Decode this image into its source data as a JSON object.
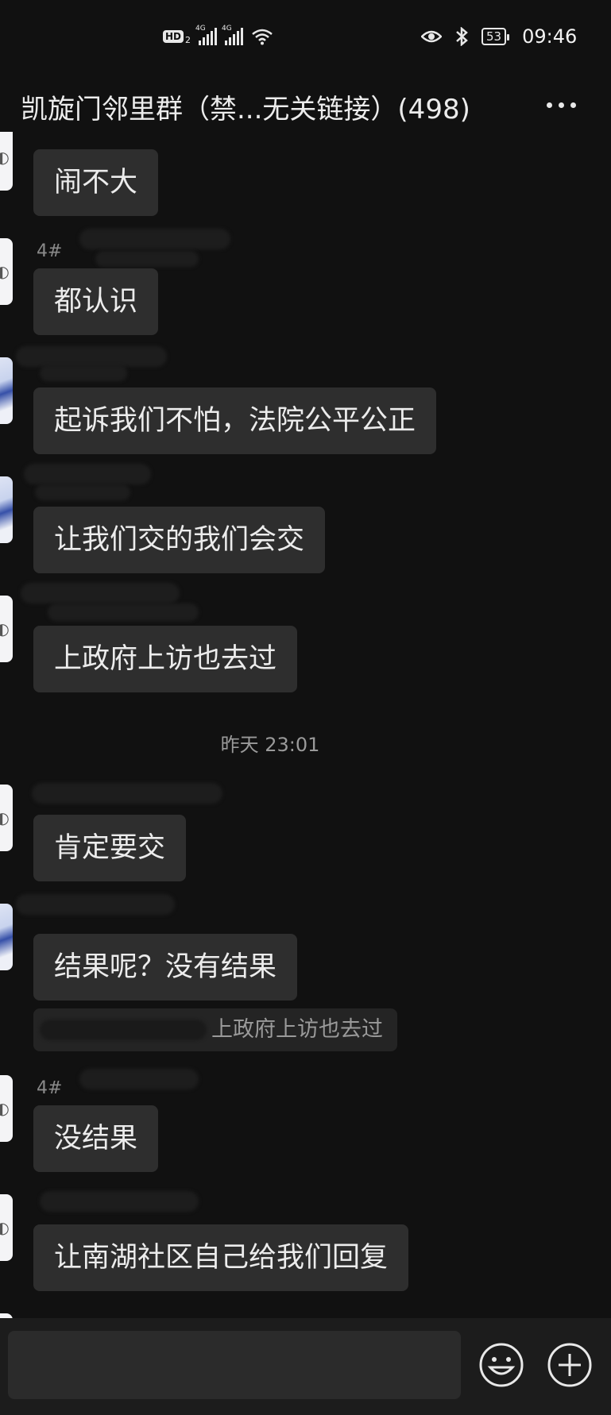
{
  "status_bar": {
    "hd_label": "HD",
    "hd_sub": "2",
    "signal_tag_1": "4G",
    "signal_tag_2": "4G",
    "battery": "53",
    "time": "09:46"
  },
  "header": {
    "title": "凯旋门邻里群（禁...无关链接）(498)",
    "more_icon": "more-dots-icon"
  },
  "messages": [
    {
      "sender": "",
      "text": "闹不大"
    },
    {
      "sender": "4#",
      "text": "都认识"
    },
    {
      "sender": "",
      "text": "起诉我们不怕，法院公平公正"
    },
    {
      "sender": "",
      "text": "让我们交的我们会交"
    },
    {
      "sender": "",
      "text": "上政府上访也去过"
    },
    {
      "sender": "",
      "text": "肯定要交"
    },
    {
      "sender": "",
      "text": "结果呢？没有结果"
    },
    {
      "sender": "4#",
      "text": "没结果"
    },
    {
      "sender": "",
      "text": "让南湖社区自己给我们回复"
    }
  ],
  "timestamp": "昨天 23:01",
  "quote": {
    "text": "上政府上访也去过"
  },
  "input_bar": {
    "placeholder": "",
    "emoji_icon": "emoji-icon",
    "plus_icon": "plus-icon"
  },
  "colors": {
    "background": "#111111",
    "bubble": "#2e2e2e",
    "text": "#ececec",
    "muted": "#8a8a8a"
  }
}
